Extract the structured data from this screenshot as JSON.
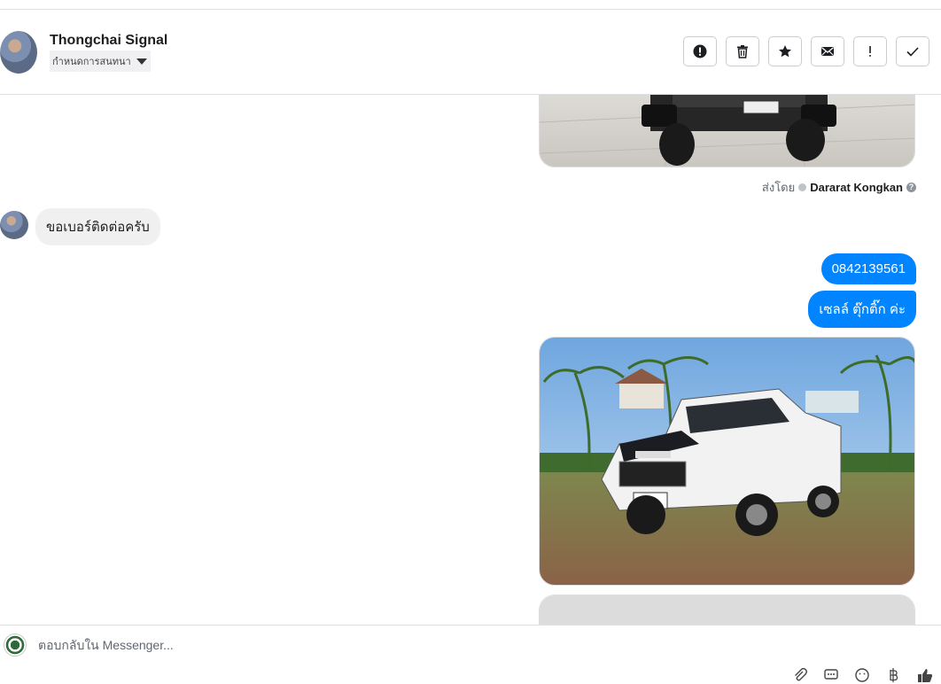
{
  "header": {
    "contact_name": "Thongchai Signal",
    "conversation_settings_label": "กำหนดการสนทนา",
    "actions": [
      {
        "name": "report-button",
        "icon": "alert-circle-icon"
      },
      {
        "name": "delete-button",
        "icon": "trash-icon"
      },
      {
        "name": "star-button",
        "icon": "star-icon"
      },
      {
        "name": "mark-unread-button",
        "icon": "envelope-icon"
      },
      {
        "name": "important-button",
        "icon": "exclamation-icon"
      },
      {
        "name": "done-button",
        "icon": "check-icon"
      }
    ]
  },
  "thread": {
    "sent_by_prefix": "ส่งโดย",
    "sent_by_name": "Dararat Kongkan",
    "incoming_message": "ขอเบอร์ติดต่อครับ",
    "outgoing_messages": [
      "0842139561",
      "เซลล์ ตุ๊กติ๊ก ค่ะ"
    ]
  },
  "composer": {
    "placeholder": "ตอบกลับใน Messenger...",
    "tools": [
      "attachment-icon",
      "chat-bubble-icon",
      "emoji-icon",
      "currency-icon",
      "like-icon"
    ]
  },
  "colors": {
    "accent": "#0084ff",
    "incoming_bubble": "#f0f0f0",
    "border": "#dddfe2"
  }
}
